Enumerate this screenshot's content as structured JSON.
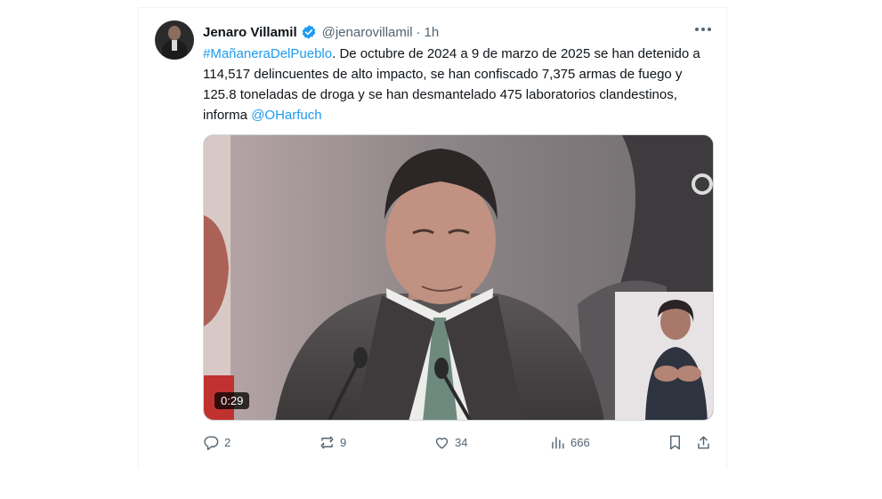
{
  "author": {
    "name": "Jenaro Villamil",
    "handle": "@jenarovillamil",
    "separator": "·",
    "time": "1h"
  },
  "tweet": {
    "hashtag": "#MañaneraDelPueblo",
    "body": ". De octubre de 2024 a 9 de marzo de 2025 se han detenido a 114,517 delincuentes de alto impacto, se han confiscado 7,375 armas de fuego y 125.8 toneladas de droga y se han desmantelado 475 laboratorios clandestinos, informa ",
    "mention": "@OHarfuch"
  },
  "media": {
    "duration": "0:29"
  },
  "actions": {
    "replies": "2",
    "reposts": "9",
    "likes": "34",
    "views": "666"
  },
  "colors": {
    "link": "#1d9bf0",
    "verified": "#1d9bf0",
    "secondary_text": "#536471"
  },
  "icons": [
    "verified-badge-icon",
    "more-icon",
    "reply-icon",
    "repost-icon",
    "like-icon",
    "views-icon",
    "bookmark-icon",
    "share-icon"
  ]
}
